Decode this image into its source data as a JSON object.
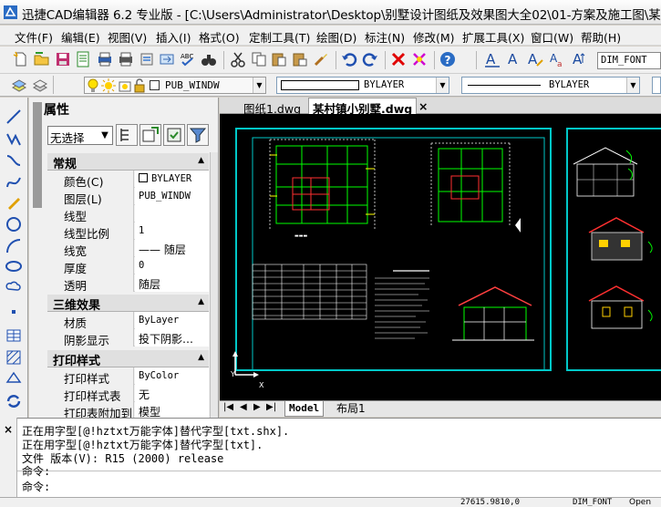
{
  "window": {
    "title": "迅捷CAD编辑器 6.2 专业版  - [C:\\Users\\Administrator\\Desktop\\别墅设计图纸及效果图大全02\\01-方案及施工图\\某村镇小别墅.dw"
  },
  "menu": [
    "文件(F)",
    "编辑(E)",
    "视图(V)",
    "插入(I)",
    "格式(O)",
    "定制工具(T)",
    "绘图(D)",
    "标注(N)",
    "修改(M)",
    "扩展工具(X)",
    "窗口(W)",
    "帮助(H)"
  ],
  "toolbar": {
    "dim_style": "DIM_FONT"
  },
  "layerbar": {
    "layer": "PUB_WINDW",
    "color": "BYLAYER",
    "linetype": "BYLAYER"
  },
  "panel": {
    "title": "属性",
    "selector": "无选择",
    "cat_general": "常规",
    "cat_3d": "三维效果",
    "cat_print": "打印样式",
    "general": [
      {
        "name": "颜色(C)",
        "value": "BYLAYER"
      },
      {
        "name": "图层(L)",
        "value": "PUB_WINDW"
      },
      {
        "name": "线型",
        "value": ""
      },
      {
        "name": "线型比例",
        "value": "1"
      },
      {
        "name": "线宽",
        "value": "—— 随层"
      },
      {
        "name": "厚度",
        "value": "0"
      },
      {
        "name": "透明",
        "value": "随层"
      }
    ],
    "three_d": [
      {
        "name": "材质",
        "value": "ByLayer"
      },
      {
        "name": "阴影显示",
        "value": "投下阴影…"
      }
    ],
    "print": [
      {
        "name": "打印样式",
        "value": "ByColor"
      },
      {
        "name": "打印样式表",
        "value": "无"
      },
      {
        "name": "打印表附加到",
        "value": "模型"
      }
    ]
  },
  "tabs": [
    {
      "label": "图纸1.dwg",
      "active": false
    },
    {
      "label": "某村镇小别墅.dwg",
      "active": true
    }
  ],
  "tab_close": "×",
  "layout_tabs": [
    "Model",
    "布局1"
  ],
  "command": {
    "lines": [
      "正在用字型[@!hztxt万能字体]替代字型[txt.shx].",
      "正在用字型[@!hztxt万能字体]替代字型[txt].",
      "文件 版本(V): R15 (2000) release",
      "命令:"
    ],
    "prompt": "命令:"
  },
  "status": {
    "coords": "27615.9810,0",
    "dim_style": "DIM_FONT",
    "mode": "Open"
  },
  "ucs": {
    "x": "X",
    "y": "Y"
  },
  "colors": {
    "cad_background": "#000000",
    "frame": "#00c8c8",
    "plan_lines": "#00ff00",
    "accent_red": "#ff0000"
  }
}
